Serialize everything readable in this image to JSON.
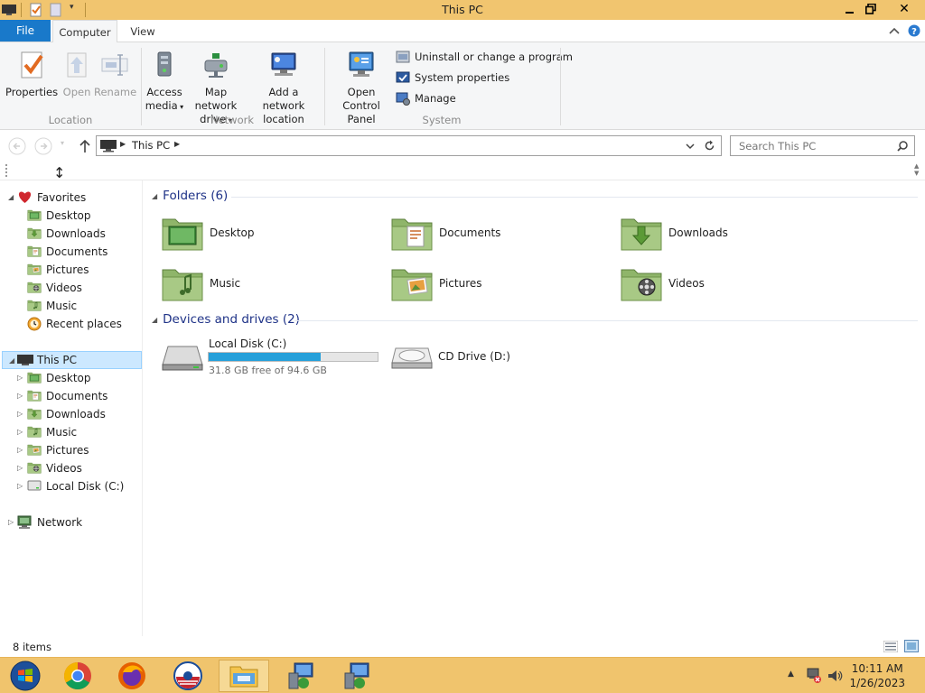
{
  "window": {
    "title": "This PC",
    "controls": [
      "minimize",
      "maximize",
      "close"
    ]
  },
  "ribbon_tabs": {
    "file": "File",
    "computer": "Computer",
    "view": "View",
    "active": "Computer"
  },
  "ribbon": {
    "location": {
      "label": "Location",
      "properties": "Properties",
      "open": "Open",
      "rename": "Rename"
    },
    "network": {
      "label": "Network",
      "access_media_1": "Access",
      "access_media_2": "media",
      "map_drive_1": "Map network",
      "map_drive_2": "drive",
      "add_location_1": "Add a network",
      "add_location_2": "location"
    },
    "system": {
      "label": "System",
      "control_panel_1": "Open Control",
      "control_panel_2": "Panel",
      "uninstall": "Uninstall or change a program",
      "system_properties": "System properties",
      "manage": "Manage"
    }
  },
  "address": {
    "path": "This PC",
    "search_placeholder": "Search This PC"
  },
  "nav": {
    "favorites": {
      "label": "Favorites",
      "items": [
        "Desktop",
        "Downloads",
        "Documents",
        "Pictures",
        "Videos",
        "Music",
        "Recent places"
      ]
    },
    "this_pc": {
      "label": "This PC",
      "items": [
        "Desktop",
        "Documents",
        "Downloads",
        "Music",
        "Pictures",
        "Videos",
        "Local Disk (C:)"
      ]
    },
    "network": "Network"
  },
  "folders": {
    "header": "Folders (6)",
    "items": [
      "Desktop",
      "Documents",
      "Downloads",
      "Music",
      "Pictures",
      "Videos"
    ]
  },
  "drives": {
    "header": "Devices and drives (2)",
    "local_disk": {
      "name": "Local Disk (C:)",
      "free_text": "31.8 GB free of 94.6 GB",
      "used_fraction": 0.664
    },
    "cd_drive": {
      "name": "CD Drive (D:)"
    }
  },
  "status": {
    "item_count": "8 items"
  },
  "taskbar": {
    "clock_time": "10:11 AM",
    "clock_date": "1/26/2023",
    "apps": [
      "start",
      "chrome",
      "firefox",
      "obama-logo",
      "file-explorer",
      "network-setup",
      "network-setup-2"
    ]
  },
  "colors": {
    "title_bar": "#f1c56f",
    "file_tab": "#1979ca",
    "group_header": "#1e3287",
    "disk_bar": "#26a0da",
    "folder_green": "#8fb56a",
    "taskbar": "#f0c46d"
  }
}
